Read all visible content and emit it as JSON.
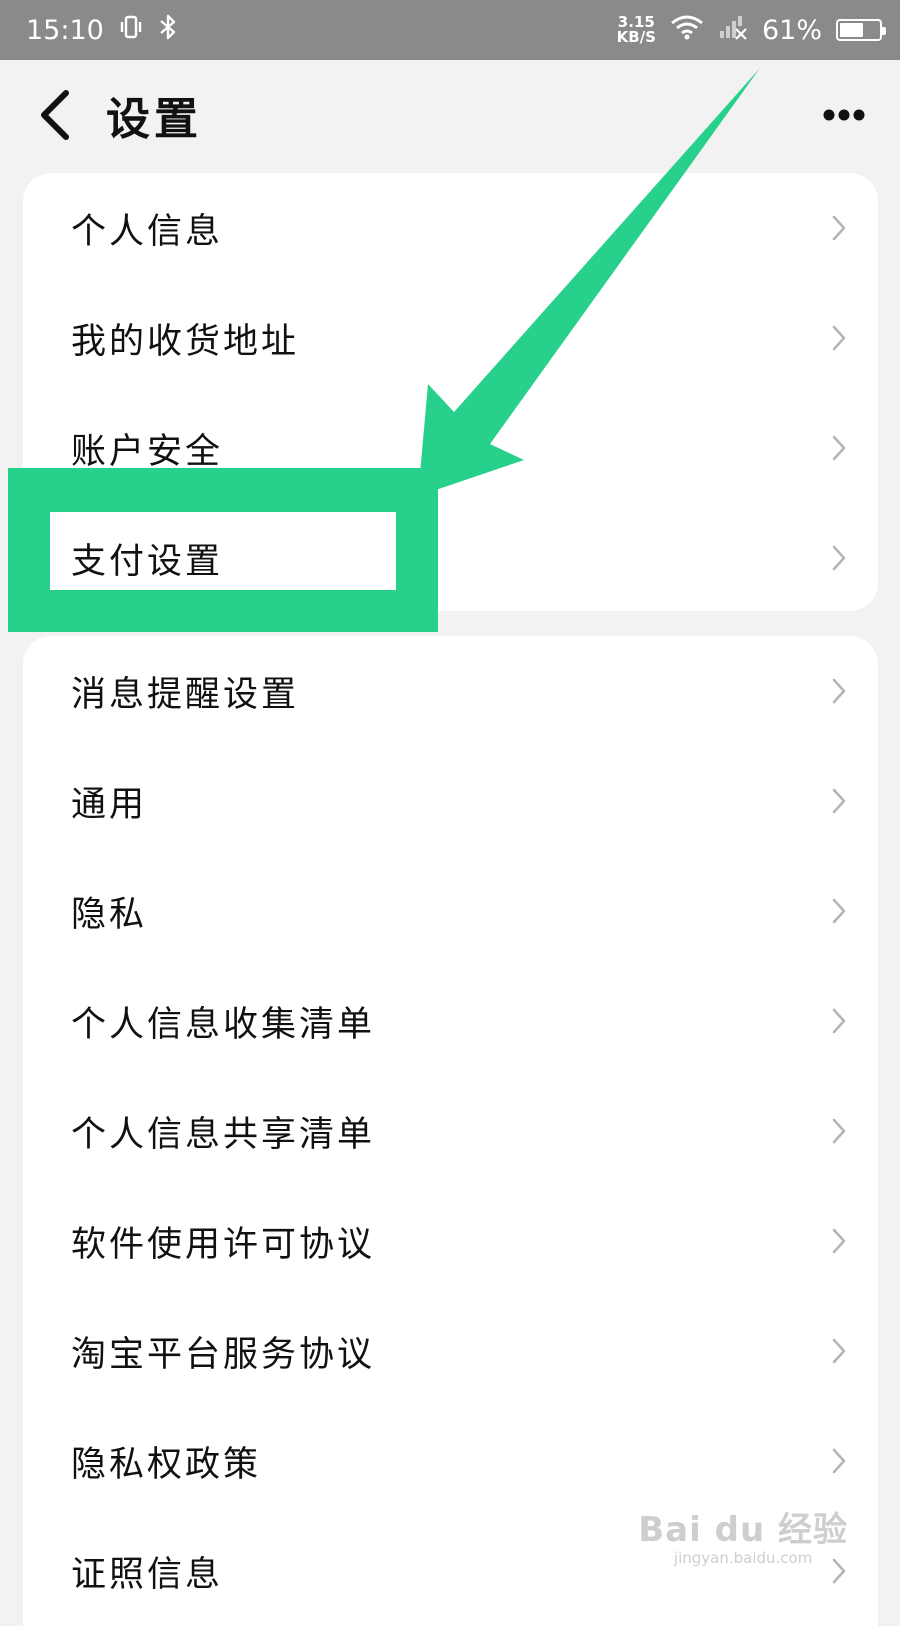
{
  "status_bar": {
    "time": "15:10",
    "vibrate_icon": "vibrate-icon",
    "bluetooth_icon": "bluetooth-icon",
    "net_speed_value": "3.15",
    "net_speed_unit": "KB/S",
    "wifi_icon": "wifi-icon",
    "signal_icon": "signal-off-icon",
    "battery_text": "61%",
    "battery_level": 0.61
  },
  "header": {
    "back_icon": "back-chevron-icon",
    "title": "设置",
    "more_icon": "more-dots-icon"
  },
  "menu_group_1": {
    "items": [
      {
        "label": "个人信息"
      },
      {
        "label": "我的收货地址"
      },
      {
        "label": "账户安全"
      },
      {
        "label": "支付设置"
      }
    ]
  },
  "menu_group_2": {
    "items": [
      {
        "label": "消息提醒设置"
      },
      {
        "label": "通用"
      },
      {
        "label": "隐私"
      },
      {
        "label": "个人信息收集清单"
      },
      {
        "label": "个人信息共享清单"
      },
      {
        "label": "软件使用许可协议"
      },
      {
        "label": "淘宝平台服务协议"
      },
      {
        "label": "隐私权政策"
      },
      {
        "label": "证照信息"
      }
    ]
  },
  "annotation": {
    "color": "#27d18b",
    "highlight_icon": "highlight-box",
    "arrow_icon": "pointer-arrow"
  },
  "watermark": {
    "brand": "Bai du 经验",
    "url": "jingyan.baidu.com"
  },
  "colors": {
    "status_bar_bg": "#8a8a8a",
    "page_bg": "#f2f2f2",
    "card_bg": "#ffffff",
    "text": "#111111",
    "chevron": "#b5b5b5",
    "annotation": "#27d18b"
  }
}
